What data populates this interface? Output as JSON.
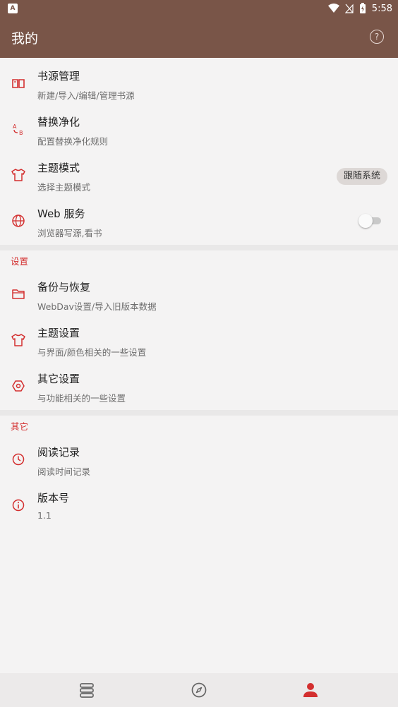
{
  "status_bar": {
    "left_icon": "A",
    "time": "5:58"
  },
  "app_bar": {
    "title": "我的",
    "help_icon": "?"
  },
  "colors": {
    "appbar": "#795548",
    "accent": "#d32f2f"
  },
  "main_items": [
    {
      "title": "书源管理",
      "subtitle": "新建/导入/编辑/管理书源",
      "icon": "book-icon"
    },
    {
      "title": "替换净化",
      "subtitle": "配置替换净化规则",
      "icon": "replace-ab-icon"
    },
    {
      "title": "主题模式",
      "subtitle": "选择主题模式",
      "icon": "shirt-icon",
      "chip": "跟随系统"
    },
    {
      "title": "Web 服务",
      "subtitle": "浏览器写源,看书",
      "icon": "globe-icon"
    }
  ],
  "settings_group": {
    "title": "设置",
    "items": [
      {
        "title": "备份与恢复",
        "subtitle": "WebDav设置/导入旧版本数据",
        "icon": "folder-icon"
      },
      {
        "title": "主题设置",
        "subtitle": "与界面/颜色相关的一些设置",
        "icon": "shirt-icon"
      },
      {
        "title": "其它设置",
        "subtitle": "与功能相关的一些设置",
        "icon": "hex-gear-icon"
      }
    ]
  },
  "other_group": {
    "title": "其它",
    "items": [
      {
        "title": "阅读记录",
        "subtitle": "阅读时间记录",
        "icon": "clock-icon"
      },
      {
        "title": "版本号",
        "subtitle": "1.1",
        "icon": "info-icon"
      }
    ]
  },
  "bottom_nav": [
    {
      "icon": "bookshelf-icon",
      "active": false
    },
    {
      "icon": "compass-icon",
      "active": false
    },
    {
      "icon": "person-icon",
      "active": true
    }
  ]
}
